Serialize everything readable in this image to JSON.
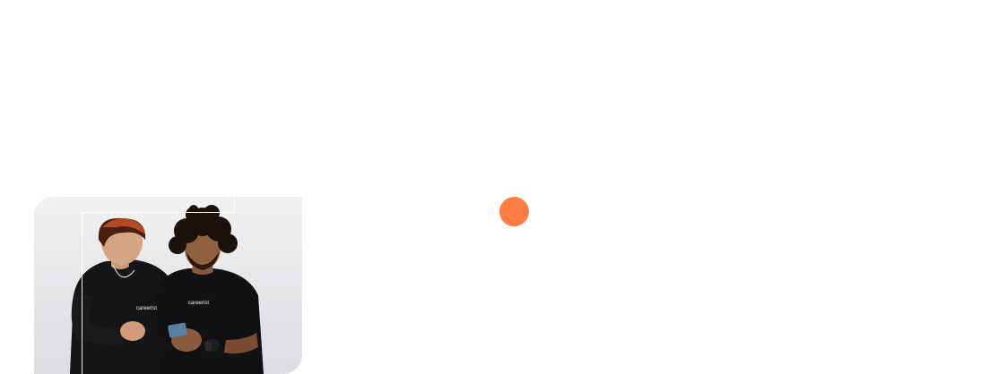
{
  "hero": {
    "image_alt": "two-people-looking-at-phone-photo",
    "shirt_text_left": "careerist",
    "shirt_text_right": "careerist"
  },
  "accent": {
    "dot_color": "#ff7d45"
  }
}
